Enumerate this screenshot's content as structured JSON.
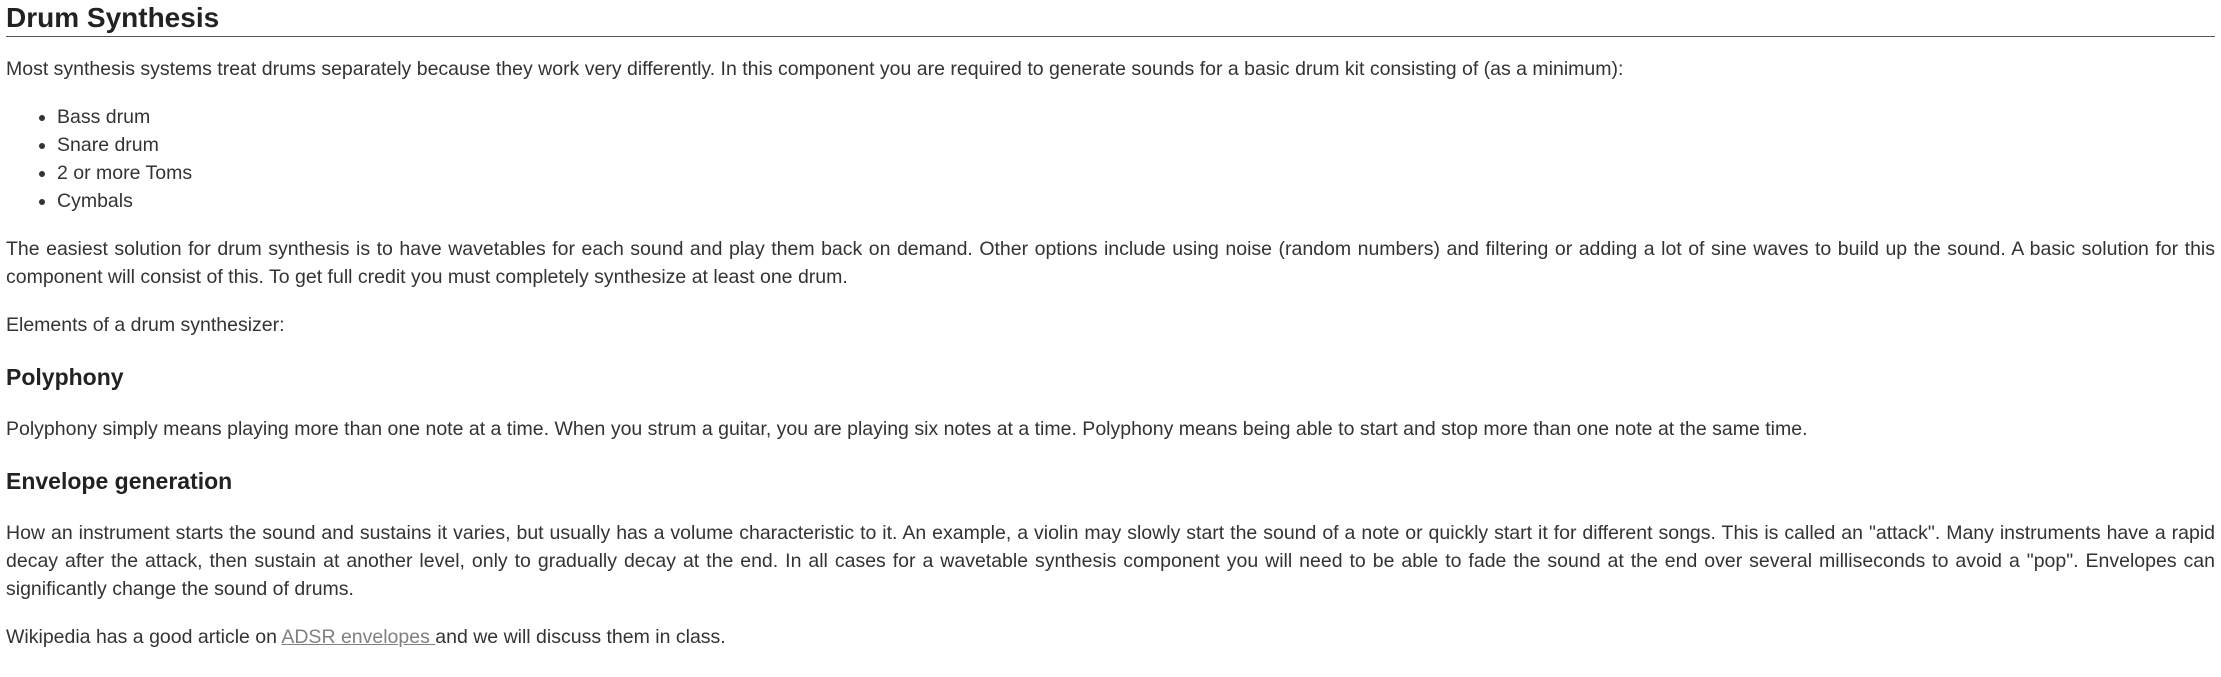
{
  "title": "Drum Synthesis",
  "intro": "Most synthesis systems treat drums separately because they work very differently.  In this component you are required to generate sounds for a basic drum kit consisting of (as a minimum):",
  "drum_kit": [
    "Bass drum",
    "Snare drum",
    "2 or more Toms",
    "Cymbals"
  ],
  "solution": "The easiest solution for drum synthesis is to have wavetables for each sound and play them back on demand.  Other options include using noise (random numbers) and filtering or adding a lot of sine waves to build up the sound.   A basic solution for this component will consist of this.  To get full credit you must completely synthesize at least one drum.",
  "elements_intro": "Elements of a drum synthesizer:",
  "polyphony": {
    "heading": "Polyphony",
    "text": "Polyphony simply means playing more than one note at a time.  When you strum a guitar, you are playing six notes at a time.  Polyphony means being able to start and stop more than one note at the same time."
  },
  "envelope": {
    "heading": "Envelope generation",
    "text": "How an instrument starts the sound and sustains it varies, but usually has a volume characteristic to it.  An example, a violin may slowly start the sound of a note or quickly start it for different songs.  This is called an \"attack\".  Many instruments have a rapid decay after the attack, then sustain at another level, only to gradually decay at the end.  In all cases for a wavetable synthesis component you will need to be able to fade the sound at the end over several milliseconds to avoid a \"pop\".  Envelopes can significantly change the sound of drums."
  },
  "wiki": {
    "before": "Wikipedia has a good article on ",
    "link": "ADSR envelopes ",
    "after": "and we will discuss them in class."
  }
}
